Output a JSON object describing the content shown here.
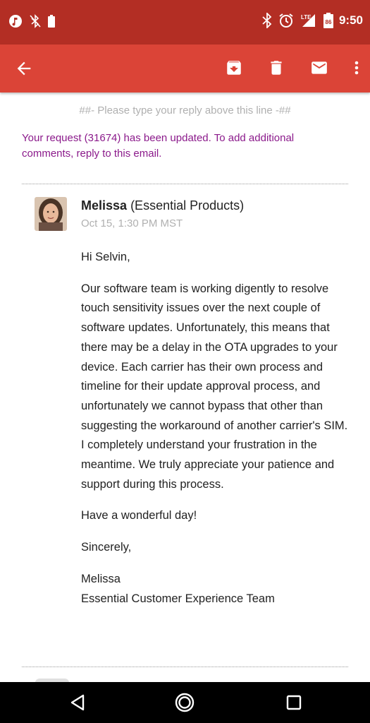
{
  "status_bar": {
    "time": "9:50",
    "icons_left": [
      "media-icon",
      "bluetooth-off-icon",
      "battery-small-icon"
    ],
    "icons_right": [
      "bluetooth-icon",
      "alarm-icon",
      "signal-lte-icon",
      "battery-icon"
    ],
    "battery_level": "86"
  },
  "app_bar": {
    "actions": [
      "archive-icon",
      "delete-icon",
      "mail-icon",
      "more-vert-icon"
    ]
  },
  "email": {
    "reply_line": "##- Please type your reply above this line -##",
    "notice": "Your request (31674) has been updated. To add additional comments, reply to this email.",
    "sender_name": "Melissa",
    "sender_org": "(Essential Products)",
    "date": "Oct 15, 1:30 PM MST",
    "greeting": "Hi Selvin,",
    "paragraph": "Our software team is working digently to resolve touch sensitivity issues over the next couple of software updates. Unfortunately, this means that there may be a delay in the OTA upgrades to your device. Each carrier has their own process and timeline for their update approval process, and unfortunately we cannot bypass that other than suggesting the workaround of another carrier's SIM. I completely understand your frustration in the meantime. We truly appreciate your patience and support during this process.",
    "closing": "Have a wonderful day!",
    "signoff": "Sincerely,",
    "signature_name": "Melissa",
    "signature_team": "Essential Customer Experience Team"
  },
  "colors": {
    "status_bar": "#b32e24",
    "app_bar": "#db4437",
    "notice_text": "#8b1a8b"
  }
}
